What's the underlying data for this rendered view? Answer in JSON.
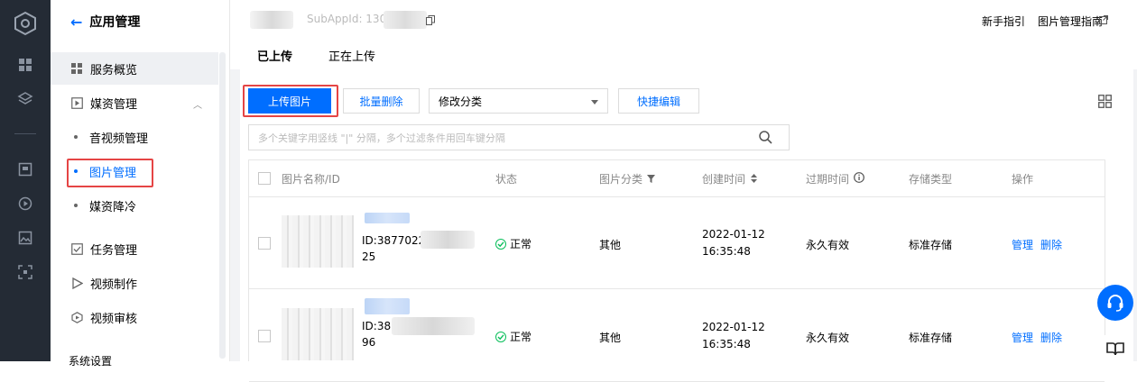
{
  "sidebar": {
    "back_label": "应用管理",
    "items": [
      {
        "label": "服务概览"
      },
      {
        "label": "媒资管理"
      },
      {
        "label": "任务管理"
      },
      {
        "label": "视频制作"
      },
      {
        "label": "视频审核"
      },
      {
        "label": "系统设置"
      }
    ],
    "subitems": [
      {
        "label": "音视频管理"
      },
      {
        "label": "图片管理"
      },
      {
        "label": "媒资降冷"
      }
    ]
  },
  "header": {
    "subapp_prefix": "SubAppId: 13000",
    "links": [
      "新手指引",
      "图片管理指南"
    ]
  },
  "tabs": [
    {
      "label": "已上传"
    },
    {
      "label": "正在上传"
    }
  ],
  "toolbar": {
    "upload_label": "上传图片",
    "batch_delete_label": "批量删除",
    "category_select": "修改分类",
    "quick_edit_label": "快捷编辑"
  },
  "search": {
    "placeholder": "多个关键字用竖线 \"|\" 分隔，多个过滤条件用回车键分隔"
  },
  "table": {
    "columns": [
      "图片名称/ID",
      "状态",
      "图片分类",
      "创建时间",
      "过期时间",
      "存储类型",
      "操作"
    ],
    "rows": [
      {
        "id_prefix": "ID:38770220",
        "id_suffix": "25",
        "status": "正常",
        "category": "其他",
        "created_date": "2022-01-12",
        "created_time": "16:35:48",
        "expire": "永久有效",
        "storage": "标准存储",
        "ops": [
          "管理",
          "删除"
        ]
      },
      {
        "id_prefix": "ID:38",
        "id_suffix": "96",
        "status": "正常",
        "category": "其他",
        "created_date": "2022-01-12",
        "created_time": "16:35:48",
        "expire": "永久有效",
        "storage": "标准存储",
        "ops": [
          "管理",
          "删除"
        ]
      }
    ]
  },
  "colors": {
    "brand": "#006eff",
    "ok": "#0abf5b",
    "highlight": "#e54545",
    "rail": "#242b35"
  }
}
